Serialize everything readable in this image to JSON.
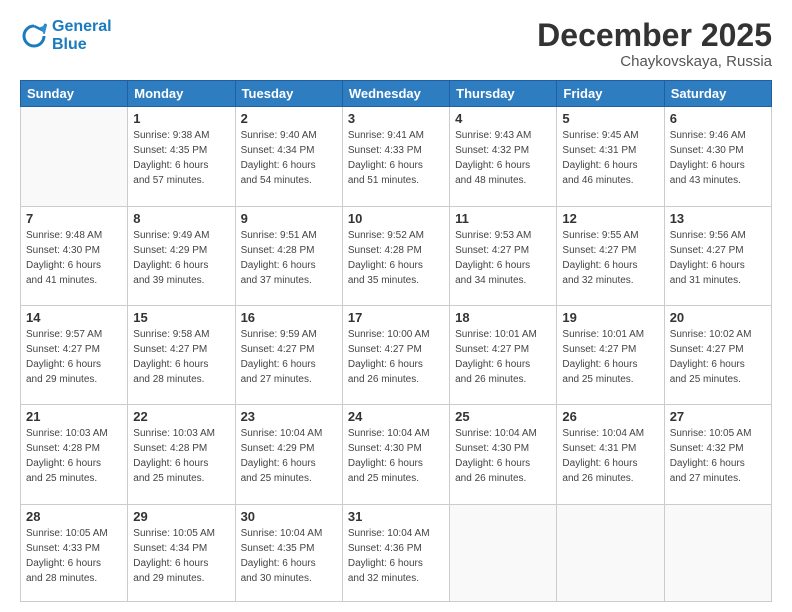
{
  "header": {
    "logo_line1": "General",
    "logo_line2": "Blue",
    "month": "December 2025",
    "location": "Chaykovskaya, Russia"
  },
  "weekdays": [
    "Sunday",
    "Monday",
    "Tuesday",
    "Wednesday",
    "Thursday",
    "Friday",
    "Saturday"
  ],
  "weeks": [
    [
      {
        "day": "",
        "info": ""
      },
      {
        "day": "1",
        "info": "Sunrise: 9:38 AM\nSunset: 4:35 PM\nDaylight: 6 hours\nand 57 minutes."
      },
      {
        "day": "2",
        "info": "Sunrise: 9:40 AM\nSunset: 4:34 PM\nDaylight: 6 hours\nand 54 minutes."
      },
      {
        "day": "3",
        "info": "Sunrise: 9:41 AM\nSunset: 4:33 PM\nDaylight: 6 hours\nand 51 minutes."
      },
      {
        "day": "4",
        "info": "Sunrise: 9:43 AM\nSunset: 4:32 PM\nDaylight: 6 hours\nand 48 minutes."
      },
      {
        "day": "5",
        "info": "Sunrise: 9:45 AM\nSunset: 4:31 PM\nDaylight: 6 hours\nand 46 minutes."
      },
      {
        "day": "6",
        "info": "Sunrise: 9:46 AM\nSunset: 4:30 PM\nDaylight: 6 hours\nand 43 minutes."
      }
    ],
    [
      {
        "day": "7",
        "info": "Sunrise: 9:48 AM\nSunset: 4:30 PM\nDaylight: 6 hours\nand 41 minutes."
      },
      {
        "day": "8",
        "info": "Sunrise: 9:49 AM\nSunset: 4:29 PM\nDaylight: 6 hours\nand 39 minutes."
      },
      {
        "day": "9",
        "info": "Sunrise: 9:51 AM\nSunset: 4:28 PM\nDaylight: 6 hours\nand 37 minutes."
      },
      {
        "day": "10",
        "info": "Sunrise: 9:52 AM\nSunset: 4:28 PM\nDaylight: 6 hours\nand 35 minutes."
      },
      {
        "day": "11",
        "info": "Sunrise: 9:53 AM\nSunset: 4:27 PM\nDaylight: 6 hours\nand 34 minutes."
      },
      {
        "day": "12",
        "info": "Sunrise: 9:55 AM\nSunset: 4:27 PM\nDaylight: 6 hours\nand 32 minutes."
      },
      {
        "day": "13",
        "info": "Sunrise: 9:56 AM\nSunset: 4:27 PM\nDaylight: 6 hours\nand 31 minutes."
      }
    ],
    [
      {
        "day": "14",
        "info": "Sunrise: 9:57 AM\nSunset: 4:27 PM\nDaylight: 6 hours\nand 29 minutes."
      },
      {
        "day": "15",
        "info": "Sunrise: 9:58 AM\nSunset: 4:27 PM\nDaylight: 6 hours\nand 28 minutes."
      },
      {
        "day": "16",
        "info": "Sunrise: 9:59 AM\nSunset: 4:27 PM\nDaylight: 6 hours\nand 27 minutes."
      },
      {
        "day": "17",
        "info": "Sunrise: 10:00 AM\nSunset: 4:27 PM\nDaylight: 6 hours\nand 26 minutes."
      },
      {
        "day": "18",
        "info": "Sunrise: 10:01 AM\nSunset: 4:27 PM\nDaylight: 6 hours\nand 26 minutes."
      },
      {
        "day": "19",
        "info": "Sunrise: 10:01 AM\nSunset: 4:27 PM\nDaylight: 6 hours\nand 25 minutes."
      },
      {
        "day": "20",
        "info": "Sunrise: 10:02 AM\nSunset: 4:27 PM\nDaylight: 6 hours\nand 25 minutes."
      }
    ],
    [
      {
        "day": "21",
        "info": "Sunrise: 10:03 AM\nSunset: 4:28 PM\nDaylight: 6 hours\nand 25 minutes."
      },
      {
        "day": "22",
        "info": "Sunrise: 10:03 AM\nSunset: 4:28 PM\nDaylight: 6 hours\nand 25 minutes."
      },
      {
        "day": "23",
        "info": "Sunrise: 10:04 AM\nSunset: 4:29 PM\nDaylight: 6 hours\nand 25 minutes."
      },
      {
        "day": "24",
        "info": "Sunrise: 10:04 AM\nSunset: 4:30 PM\nDaylight: 6 hours\nand 25 minutes."
      },
      {
        "day": "25",
        "info": "Sunrise: 10:04 AM\nSunset: 4:30 PM\nDaylight: 6 hours\nand 26 minutes."
      },
      {
        "day": "26",
        "info": "Sunrise: 10:04 AM\nSunset: 4:31 PM\nDaylight: 6 hours\nand 26 minutes."
      },
      {
        "day": "27",
        "info": "Sunrise: 10:05 AM\nSunset: 4:32 PM\nDaylight: 6 hours\nand 27 minutes."
      }
    ],
    [
      {
        "day": "28",
        "info": "Sunrise: 10:05 AM\nSunset: 4:33 PM\nDaylight: 6 hours\nand 28 minutes."
      },
      {
        "day": "29",
        "info": "Sunrise: 10:05 AM\nSunset: 4:34 PM\nDaylight: 6 hours\nand 29 minutes."
      },
      {
        "day": "30",
        "info": "Sunrise: 10:04 AM\nSunset: 4:35 PM\nDaylight: 6 hours\nand 30 minutes."
      },
      {
        "day": "31",
        "info": "Sunrise: 10:04 AM\nSunset: 4:36 PM\nDaylight: 6 hours\nand 32 minutes."
      },
      {
        "day": "",
        "info": ""
      },
      {
        "day": "",
        "info": ""
      },
      {
        "day": "",
        "info": ""
      }
    ]
  ]
}
